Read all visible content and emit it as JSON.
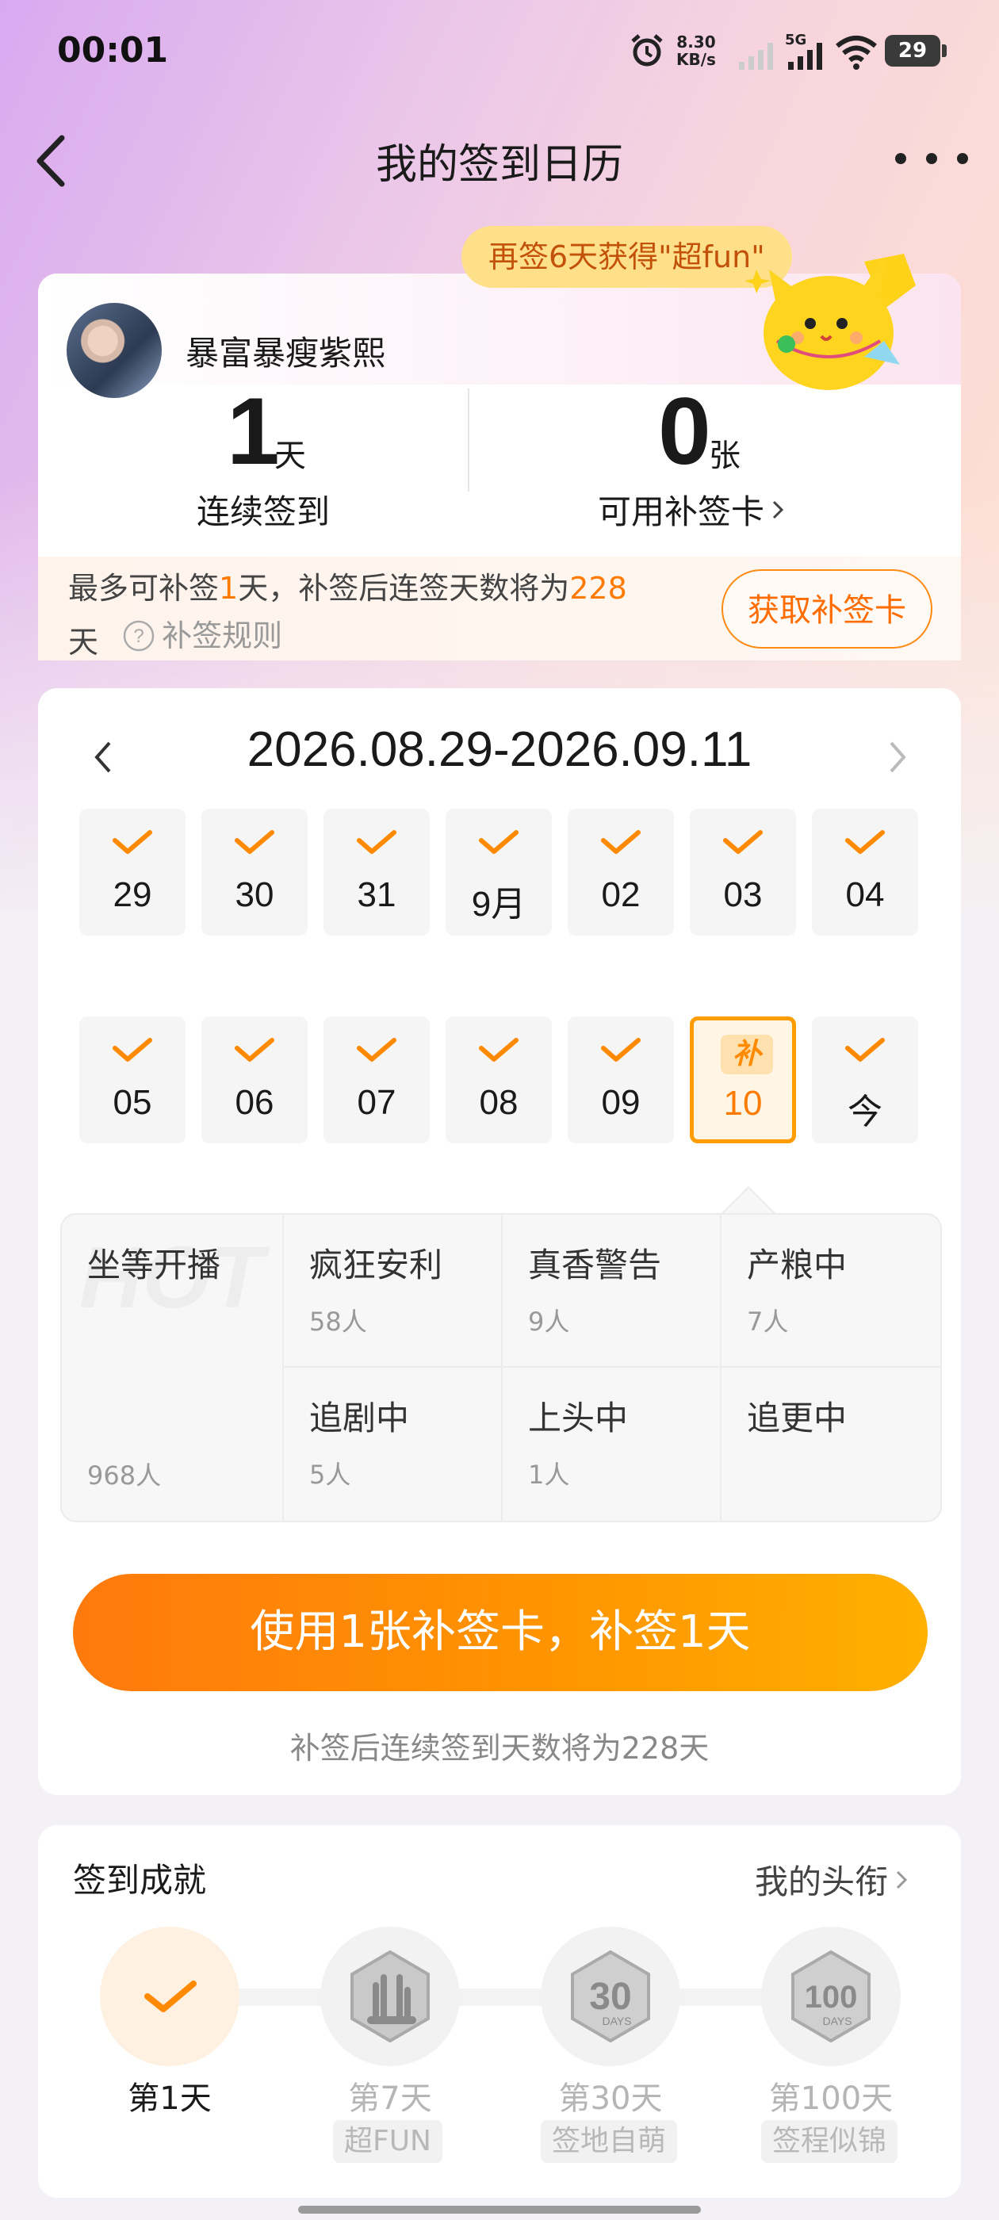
{
  "status_bar": {
    "time": "00:01",
    "speed_value": "8.30",
    "speed_unit": "KB/s",
    "network": "5G",
    "battery": "29"
  },
  "nav": {
    "title": "我的签到日历"
  },
  "profile": {
    "username": "暴富暴瘦紫熙",
    "streak_value": "1",
    "streak_unit": "天",
    "streak_label": "连续签到",
    "cards_value": "0",
    "cards_unit": "张",
    "cards_label": "可用补签卡",
    "tip_bubble": "再签6天获得\"超fun\"",
    "makeup_pre": "最多可补签",
    "makeup_days": "1",
    "makeup_mid": "天，补签后连签天数将为",
    "makeup_total": "228",
    "makeup_end": "天",
    "rules_label": "补签规则",
    "get_card_button": "获取补签卡"
  },
  "calendar": {
    "range": "2026.08.29-2026.09.11",
    "row1": [
      "29",
      "30",
      "31",
      "9月",
      "02",
      "03",
      "04"
    ],
    "row2": [
      "05",
      "06",
      "07",
      "08",
      "09",
      "10",
      "今"
    ],
    "selected_tag": "补"
  },
  "tags": {
    "hot_watermark": "HOT",
    "main": {
      "title": "坐等开播",
      "count": "968人"
    },
    "items": [
      {
        "title": "疯狂安利",
        "count": "58人"
      },
      {
        "title": "真香警告",
        "count": "9人"
      },
      {
        "title": "产粮中",
        "count": "7人"
      },
      {
        "title": "追剧中",
        "count": "5人"
      },
      {
        "title": "上头中",
        "count": "1人"
      },
      {
        "title": "追更中",
        "count": ""
      }
    ]
  },
  "action": {
    "button": "使用1张补签卡，补签1天",
    "note": "补签后连续签到天数将为228天"
  },
  "achievements": {
    "title": "签到成就",
    "link": "我的头衔",
    "items": [
      {
        "day": "第1天",
        "name": ""
      },
      {
        "day": "第7天",
        "name": "超FUN"
      },
      {
        "day": "第30天",
        "name": "签地自萌"
      },
      {
        "day": "第100天",
        "name": "签程似锦"
      }
    ],
    "badge_30": "30",
    "badge_100": "100",
    "badge_unit": "DAYS"
  },
  "colors": {
    "accent": "#ff7b00",
    "button_start": "#ff7a0d",
    "button_end": "#ffb000",
    "bubble": "#ffe08a"
  }
}
